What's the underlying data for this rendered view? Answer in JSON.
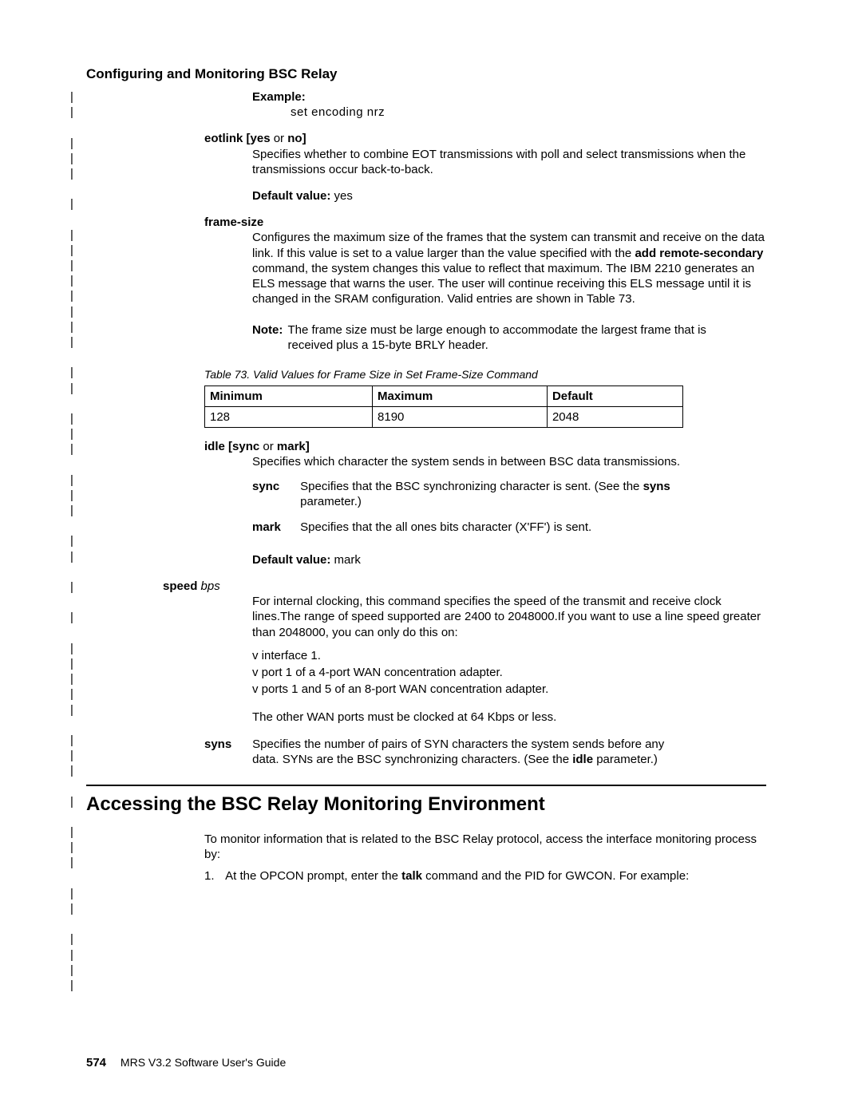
{
  "running_head": "Configuring and Monitoring BSC Relay",
  "example": {
    "label": "Example:",
    "text": "set  encoding  nrz"
  },
  "eotlink": {
    "term_prefix": "eotlink [",
    "opt1": "yes",
    "or": " or ",
    "opt2": "no",
    "term_suffix": "]",
    "desc": "Specifies whether to combine EOT transmissions with poll and select transmissions when the transmissions occur back-to-back.",
    "default_label": "Default value:",
    "default_value": " yes"
  },
  "framesize": {
    "term": "frame-size",
    "desc_pre": "Configures the maximum size of the frames that the system can transmit and receive on the data link. If this value is set to a value larger than the value specified with the ",
    "cmd": "add remote-secondary",
    "desc_post": " command, the system changes this value to reflect that maximum. The IBM 2210 generates an ELS message that warns the user. The user will continue receiving this ELS message until it is changed in the SRAM configuration. Valid entries are shown in Table 73.",
    "note_label": "Note:",
    "note_body": "  The frame size must be large enough to accommodate the largest frame that is received plus a 15-byte BRLY header.",
    "table_caption": "Table 73. Valid Values for Frame Size in Set Frame-Size Command",
    "col1": "Minimum",
    "col2": "Maximum",
    "col3": "Default",
    "v1": "128",
    "v2": "8190",
    "v3": "2048"
  },
  "idle": {
    "term_prefix": "idle [",
    "opt1": "sync",
    "or": " or ",
    "opt2": "mark",
    "term_suffix": "]",
    "desc": "Specifies which character the system sends in between BSC data transmissions.",
    "sync_term": "sync",
    "sync_body_pre": "Specifies that the BSC synchronizing character is sent. (See the ",
    "sync_body_bold": "syns",
    "sync_body_post": " parameter.)",
    "mark_term": "mark",
    "mark_body": "Specifies that the all ones bits character (X'FF') is sent.",
    "default_label": "Default value:",
    "default_value": " mark"
  },
  "speed": {
    "term": "speed",
    "term_arg": " bps",
    "desc": "For internal clocking, this command specifies the speed of the transmit and receive clock lines.The range of speed supported are 2400 to 2048000.If you want to use a line speed greater than 2048000, you can only do this on:",
    "b1": "interface 1.",
    "b2": "port 1 of a 4-port WAN concentration adapter.",
    "b3": "ports 1 and 5 of an 8-port WAN concentration adapter.",
    "tail": "The other WAN ports must be clocked at 64 Kbps or less."
  },
  "syns": {
    "term": "syns",
    "desc_pre": "Specifies the number of pairs of SYN characters the system sends before any data. SYNs are the BSC synchronizing characters. (See the ",
    "desc_bold": "idle",
    "desc_post": " parameter.)"
  },
  "section_heading": "Accessing the BSC Relay Monitoring Environment",
  "monitor_intro": "To monitor information that is related to the BSC Relay protocol, access the interface monitoring process by:",
  "step1_pre": "At the OPCON prompt, enter the ",
  "step1_bold": "talk",
  "step1_post": " command and the PID for GWCON. For example:",
  "footer": {
    "page": "574",
    "title": "MRS V3.2 Software User's Guide"
  }
}
